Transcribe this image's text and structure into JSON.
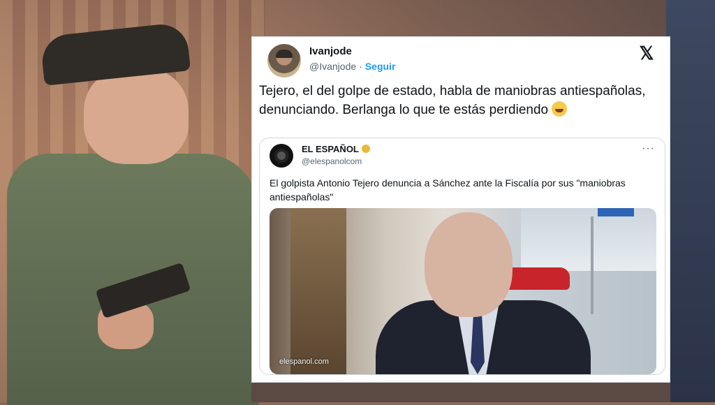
{
  "tweet": {
    "author_name": "Ivanjode",
    "author_handle": "@Ivanjode",
    "separator": "·",
    "follow_label": "Seguir",
    "brand_icon": "x-logo",
    "brand_glyph": "𝕏",
    "text": "Tejero, el del golpe de estado, habla de maniobras antiespañolas, denunciando. Berlanga lo que te estás perdiendo",
    "emoji": "rolling-on-floor-laughing-emoji"
  },
  "quote": {
    "author_name": "EL ESPAÑOL",
    "author_handle": "@elespanolcom",
    "more_label": "···",
    "text": "El golpista Antonio Tejero denuncia a Sánchez ante la Fiscalía por sus \"maniobras antiespañolas\"",
    "image_watermark": "elespanol.com"
  },
  "colors": {
    "accent": "#1d9bf0",
    "text": "#0f1419",
    "muted": "#536471",
    "card_bg": "#ffffff",
    "border": "#cfd9de"
  }
}
